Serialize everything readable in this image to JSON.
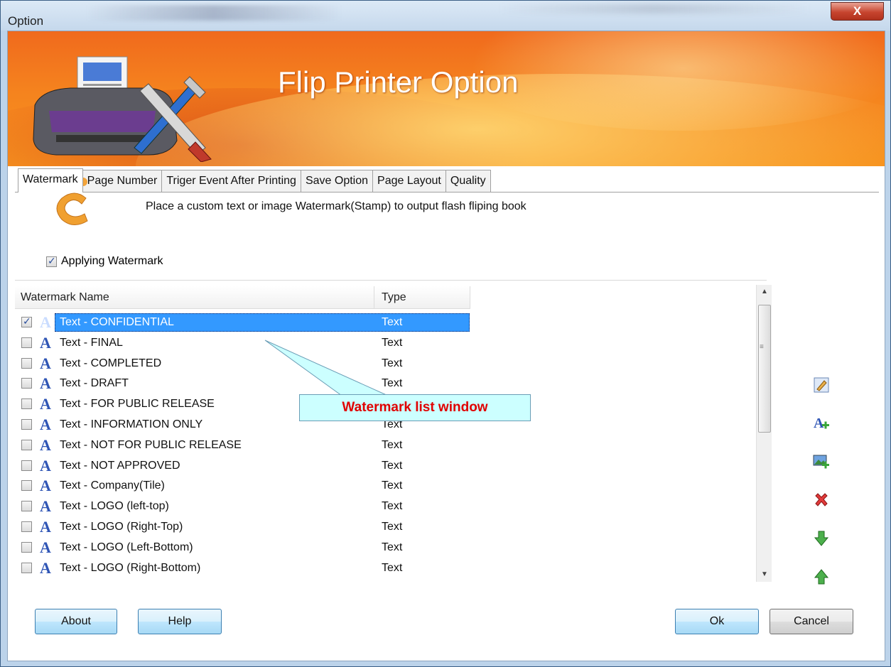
{
  "window": {
    "title": "Option",
    "close_label": "X"
  },
  "banner": {
    "title": "Flip Printer Option"
  },
  "tabs": [
    {
      "label": "Watermark",
      "active": true
    },
    {
      "label": "Page Number",
      "active": false
    },
    {
      "label": "Triger Event After Printing",
      "active": false
    },
    {
      "label": "Save Option",
      "active": false
    },
    {
      "label": "Page Layout",
      "active": false
    },
    {
      "label": "Quality",
      "active": false
    }
  ],
  "watermark": {
    "description": "Place a custom text or image Watermark(Stamp) to output flash fliping book",
    "apply_label": "Applying Watermark",
    "apply_checked": true,
    "columns": {
      "name": "Watermark Name",
      "type": "Type"
    },
    "rows": [
      {
        "name": "Text - CONFIDENTIAL",
        "type": "Text",
        "checked": true,
        "selected": true
      },
      {
        "name": "Text - FINAL",
        "type": "Text",
        "checked": false,
        "selected": false
      },
      {
        "name": "Text - COMPLETED",
        "type": "Text",
        "checked": false,
        "selected": false
      },
      {
        "name": "Text - DRAFT",
        "type": "Text",
        "checked": false,
        "selected": false
      },
      {
        "name": "Text - FOR PUBLIC RELEASE",
        "type": "Text",
        "checked": false,
        "selected": false
      },
      {
        "name": "Text - INFORMATION ONLY",
        "type": "Text",
        "checked": false,
        "selected": false
      },
      {
        "name": "Text - NOT FOR PUBLIC RELEASE",
        "type": "Text",
        "checked": false,
        "selected": false
      },
      {
        "name": "Text - NOT APPROVED",
        "type": "Text",
        "checked": false,
        "selected": false
      },
      {
        "name": "Text - Company(Tile)",
        "type": "Text",
        "checked": false,
        "selected": false
      },
      {
        "name": "Text - LOGO (left-top)",
        "type": "Text",
        "checked": false,
        "selected": false
      },
      {
        "name": "Text - LOGO (Right-Top)",
        "type": "Text",
        "checked": false,
        "selected": false
      },
      {
        "name": "Text - LOGO (Left-Bottom)",
        "type": "Text",
        "checked": false,
        "selected": false
      },
      {
        "name": "Text - LOGO (Right-Bottom)",
        "type": "Text",
        "checked": false,
        "selected": false
      }
    ],
    "side_actions": [
      "edit-icon",
      "add-text-icon",
      "add-image-icon",
      "delete-icon",
      "move-down-icon",
      "move-up-icon"
    ]
  },
  "callout": {
    "text": "Watermark list window"
  },
  "buttons": {
    "about": "About",
    "help": "Help",
    "ok": "Ok",
    "cancel": "Cancel"
  },
  "colors": {
    "banner_orange": "#f5831e",
    "selection_blue": "#3399ff",
    "callout_text": "#e00000",
    "callout_bg": "#ccffff"
  }
}
